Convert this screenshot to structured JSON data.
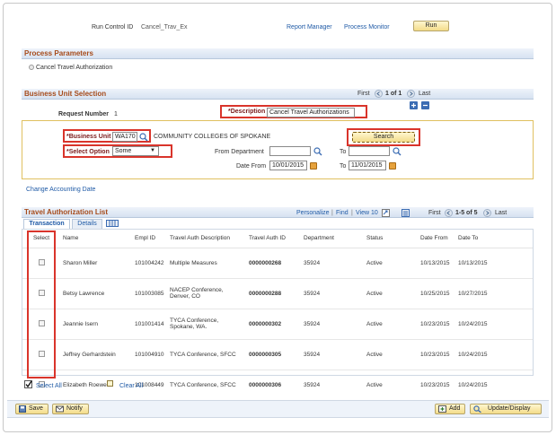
{
  "header": {
    "run_control_label": "Run Control ID",
    "run_control_value": "Cancel_Trav_Ex",
    "report_manager": "Report Manager",
    "process_monitor": "Process Monitor",
    "run_button": "Run"
  },
  "process_parameters": {
    "title": "Process Parameters",
    "radio_label": "Cancel Travel Authorization"
  },
  "business_unit_selection": {
    "title": "Business Unit Selection",
    "nav_first": "First",
    "nav_range": "1 of 1",
    "nav_last": "Last",
    "request_number_label": "Request Number",
    "request_number_value": "1",
    "description_label": "*Description",
    "description_value": "Cancel Travel Authorizations",
    "business_unit_label": "*Business Unit",
    "business_unit_value": "WA170",
    "business_unit_name": "COMMUNITY COLLEGES OF SPOKANE",
    "select_option_label": "*Select Option",
    "select_option_value": "Some",
    "from_department_label": "From Department",
    "to_label": "To",
    "date_from_label": "Date From",
    "date_from_value": "10/01/2015",
    "date_to_label": "To",
    "date_to_value": "11/01/2015",
    "search_button": "Search"
  },
  "change_accounting_date": "Change Accounting Date",
  "travel_list": {
    "title": "Travel Authorization List",
    "personalize": "Personalize",
    "find": "Find",
    "view": "View 10",
    "nav_first": "First",
    "nav_range": "1-5 of 5",
    "nav_last": "Last",
    "tabs": [
      "Transaction",
      "Details"
    ],
    "columns": [
      "Select",
      "Name",
      "Empl ID",
      "Travel Auth Description",
      "Travel Auth ID",
      "Department",
      "Status",
      "Date From",
      "Date To"
    ],
    "rows": [
      {
        "name": "Sharon Miller",
        "empl_id": "101004242",
        "desc1": "Multiple Measures",
        "desc2": "",
        "auth_id": "0000000268",
        "dept": "35924",
        "status": "Active",
        "date_from": "10/13/2015",
        "date_to": "10/13/2015"
      },
      {
        "name": "Betsy Lawrence",
        "empl_id": "101003085",
        "desc1": "NACEP Conference,",
        "desc2": "Denver, CO",
        "auth_id": "0000000288",
        "dept": "35924",
        "status": "Active",
        "date_from": "10/25/2015",
        "date_to": "10/27/2015"
      },
      {
        "name": "Jeannie Isern",
        "empl_id": "101001414",
        "desc1": "TYCA Conference,",
        "desc2": "Spokane, WA.",
        "auth_id": "0000000302",
        "dept": "35924",
        "status": "Active",
        "date_from": "10/23/2015",
        "date_to": "10/24/2015"
      },
      {
        "name": "Jeffrey Gerhardstein",
        "empl_id": "101004910",
        "desc1": "TYCA Conference, SFCC",
        "desc2": "",
        "auth_id": "0000000305",
        "dept": "35924",
        "status": "Active",
        "date_from": "10/23/2015",
        "date_to": "10/24/2015"
      },
      {
        "name": "Elizabeth Roewe",
        "empl_id": "101008449",
        "desc1": "TYCA Conference, SFCC",
        "desc2": "",
        "auth_id": "0000000306",
        "dept": "35924",
        "status": "Active",
        "date_from": "10/23/2015",
        "date_to": "10/24/2015"
      }
    ],
    "select_all": "Select All",
    "clear_all": "Clear All"
  },
  "footer": {
    "save": "Save",
    "notify": "Notify",
    "add": "Add",
    "update_display": "Update/Display"
  },
  "colors": {
    "section_title": "#a64b1b",
    "link": "#1f5aa6",
    "highlight": "#d9342b",
    "button": "#f3dc8a"
  }
}
